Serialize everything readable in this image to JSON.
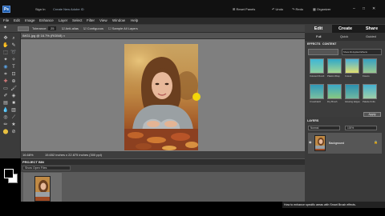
{
  "topbar": {
    "app_logo": "Ps",
    "sign_in": "Sign In",
    "create_id": "Create New Adobe ID",
    "reset_panels": "Reset Panels",
    "undo": "Undo",
    "redo": "Redo",
    "organizer": "Organizer"
  },
  "menubar": {
    "items": [
      "File",
      "Edit",
      "Image",
      "Enhance",
      "Layer",
      "Select",
      "Filter",
      "View",
      "Window",
      "Help"
    ]
  },
  "options": {
    "tolerance_label": "Tolerance:",
    "tolerance_value": "25",
    "anti_alias": "Anti-alias",
    "contiguous": "Contiguous",
    "sample_all": "Sample All Layers"
  },
  "document": {
    "tab": "IMG1.jpg @ 16.7% (RGB/8) ×",
    "zoom": "16.68%",
    "size": "15.652 inches x 22.875 inches (300 ppi)"
  },
  "project_bin": {
    "title": "PROJECT BIN",
    "show": "Show Open Files"
  },
  "panels": {
    "tabs": [
      "Edit",
      "Create",
      "Share"
    ],
    "subtabs": [
      "Full",
      "Quick",
      "Guided"
    ],
    "effects_title": "EFFECTS",
    "content_title": "CONTENT",
    "effects_filter": "Show All Applied Effects",
    "effects": [
      "Colored Pencil",
      "Plastic Wrap",
      "Cutout",
      "Fresco",
      "Crosshatch",
      "Dry Brush",
      "Glowing Edges",
      "Palette Knife"
    ],
    "apply": "Apply",
    "layers_title": "LAYERS",
    "blend_mode": "Normal",
    "opacity": "100%",
    "layer_name": "Background"
  },
  "tooltip": "How to enhance specific areas with Smart Brush effects.",
  "colors": {
    "accent": "#1f5fb0",
    "panel": "#3a3a3a",
    "canvas_bg": "#7f7f7f",
    "fx_thumb": "#2fa8c8"
  },
  "icons": [
    "home-icon",
    "lasso-icon",
    "magic-wand-icon",
    "eye-icon",
    "zoom-icon",
    "hand-icon",
    "move-icon",
    "type-icon",
    "brush-icon",
    "eraser-icon",
    "paint-bucket-icon",
    "gradient-icon",
    "shape-icon",
    "blur-icon",
    "sponge-icon",
    "clone-icon",
    "eyedropper-icon",
    "crop-icon",
    "undo-icon",
    "redo-icon",
    "organizer-icon",
    "lock-icon",
    "eye-visibility-icon"
  ]
}
